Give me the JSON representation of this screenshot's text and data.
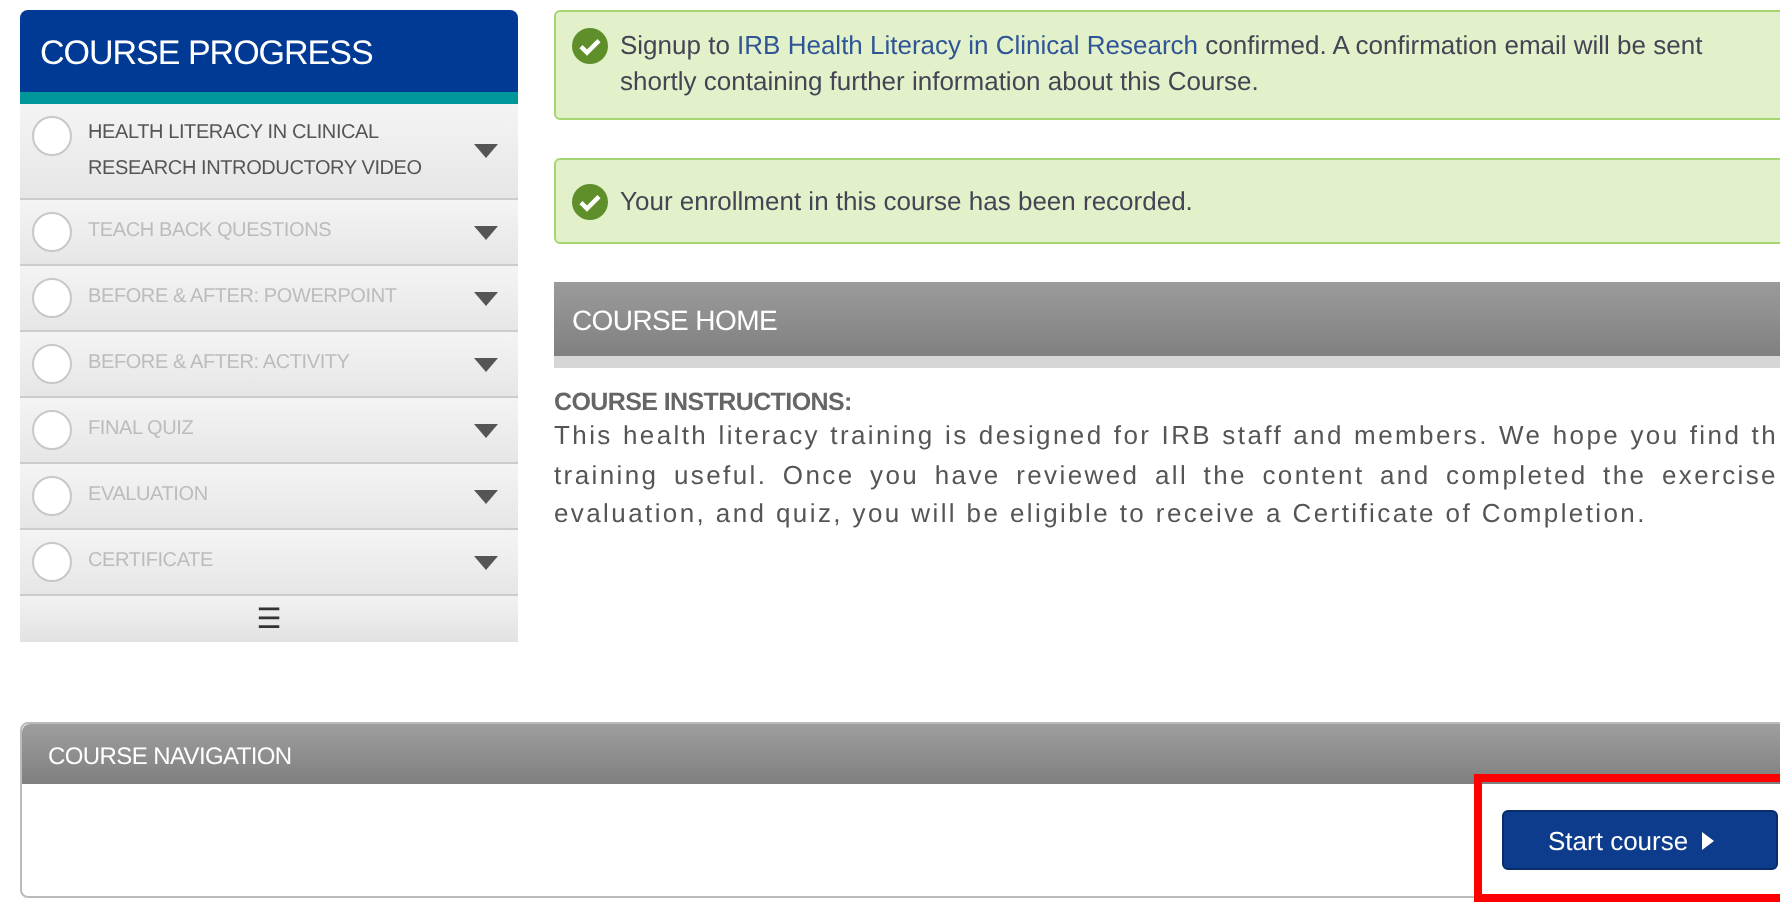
{
  "sidebar": {
    "title": "COURSE PROGRESS",
    "items": [
      {
        "label": "HEALTH LITERACY IN CLINICAL RESEARCH INTRODUCTORY VIDEO",
        "disabled": false
      },
      {
        "label": "TEACH BACK QUESTIONS",
        "disabled": true
      },
      {
        "label": "BEFORE & AFTER: POWERPOINT",
        "disabled": true
      },
      {
        "label": "BEFORE & AFTER: ACTIVITY",
        "disabled": true
      },
      {
        "label": "FINAL QUIZ",
        "disabled": true
      },
      {
        "label": "EVALUATION",
        "disabled": true
      },
      {
        "label": "CERTIFICATE",
        "disabled": true
      }
    ],
    "menu_glyph": "☰"
  },
  "alerts": [
    {
      "text": "Signup to ",
      "link": "IRB Health Literacy in Clinical Research",
      "text_after": " confirmed. A confirmation email will be sent shortly containing further information about this Course."
    },
    {
      "text": "Your enrollment in this course has been recorded."
    }
  ],
  "course_home": {
    "title": "COURSE HOME",
    "heading": "COURSE INSTRUCTIONS:",
    "text": "This health literacy training is designed for IRB staff and members. We hope you find th training useful. Once you have reviewed all the content and completed the exercise evaluation, and quiz, you will be eligible to receive a Certificate of Completion."
  },
  "navigation": {
    "title": "COURSE NAVIGATION",
    "button": {
      "label": "Start course",
      "highlighted": true
    }
  }
}
